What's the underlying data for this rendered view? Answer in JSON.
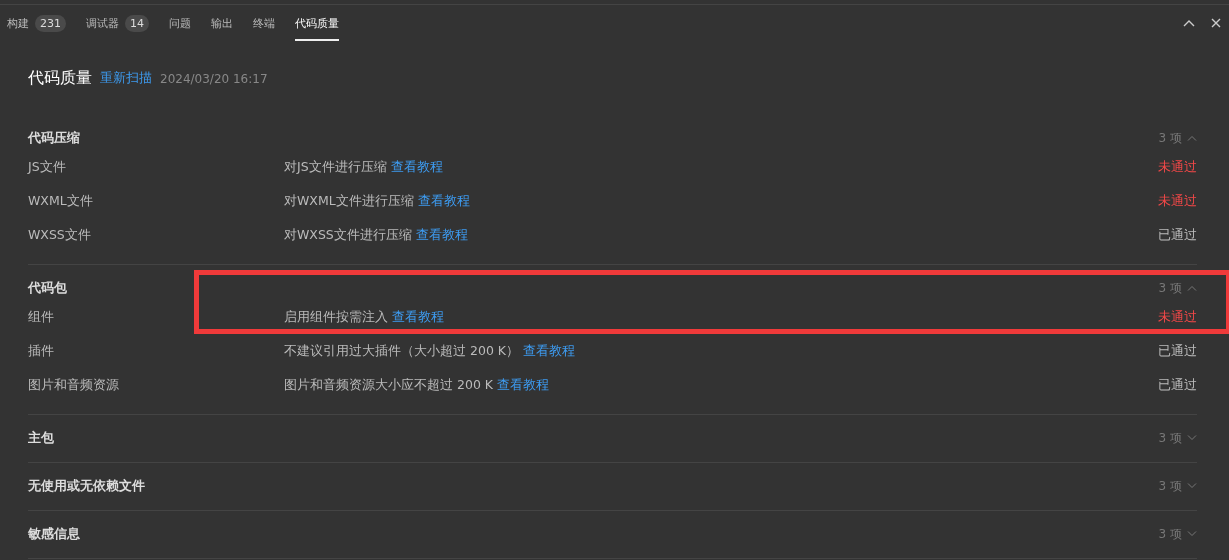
{
  "tabs": [
    {
      "label": "构建",
      "count": "231",
      "selected": false
    },
    {
      "label": "调试器",
      "count": "14",
      "selected": false
    },
    {
      "label": "问题",
      "selected": false
    },
    {
      "label": "输出",
      "selected": false
    },
    {
      "label": "终端",
      "selected": false
    },
    {
      "label": "代码质量",
      "selected": true
    }
  ],
  "header": {
    "title": "代码质量",
    "action": "重新扫描",
    "timestamp": "2024/03/20 16:17"
  },
  "groups": [
    {
      "title": "代码压缩",
      "count": "3 项",
      "expanded": true,
      "rows": [
        {
          "name": "JS文件",
          "description": "对JS文件进行压缩",
          "link": "查看教程",
          "status": "未通过",
          "passed": false
        },
        {
          "name": "WXML文件",
          "description": "对WXML文件进行压缩",
          "link": "查看教程",
          "status": "未通过",
          "passed": false
        },
        {
          "name": "WXSS文件",
          "description": "对WXSS文件进行压缩",
          "link": "查看教程",
          "status": "已通过",
          "passed": true
        }
      ]
    },
    {
      "title": "代码包",
      "count": "3 项",
      "expanded": true,
      "rows": [
        {
          "name": "组件",
          "description": "启用组件按需注入",
          "link": "查看教程",
          "status": "未通过",
          "passed": false,
          "highlighted": true
        },
        {
          "name": "插件",
          "description": "不建议引用过大插件（大小超过 200 K）",
          "link": "查看教程",
          "status": "已通过",
          "passed": true,
          "highlighted": false
        },
        {
          "name": "图片和音频资源",
          "description": "图片和音频资源大小应不超过 200 K",
          "link": "查看教程",
          "status": "已通过",
          "passed": true,
          "highlighted": false
        }
      ]
    },
    {
      "title": "主包",
      "count": "3 项",
      "expanded": false
    },
    {
      "title": "无使用或无依赖文件",
      "count": "3 项",
      "expanded": false
    },
    {
      "title": "敏感信息",
      "count": "3 项",
      "expanded": false
    }
  ]
}
